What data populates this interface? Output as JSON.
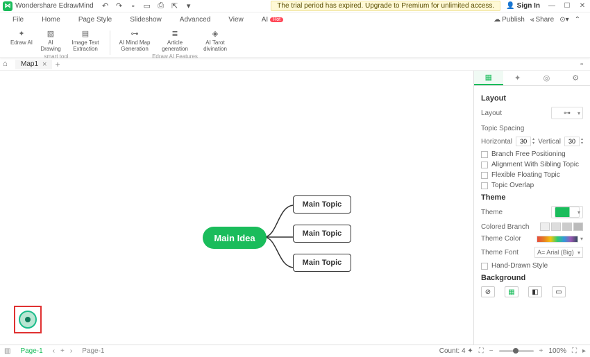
{
  "app": {
    "title": "Wondershare EdrawMind",
    "trial_msg": "The trial period has expired. Upgrade to Premium for unlimited access.",
    "signin": "Sign In"
  },
  "menus": {
    "file": "File",
    "home": "Home",
    "page_style": "Page Style",
    "slideshow": "Slideshow",
    "advanced": "Advanced",
    "view": "View",
    "ai": "AI",
    "ai_badge": "Hot",
    "publish": "Publish",
    "share": "Share"
  },
  "ribbon": {
    "group1_label": "smart tool",
    "group2_label": "Edraw AI Features",
    "edraw_ai": "Edraw\nAI",
    "ai_drawing": "AI\nDrawing",
    "image_text": "Image Text\nExtraction",
    "ai_mindmap": "AI Mind Map\nGeneration",
    "article": "Article\ngeneration",
    "tarot": "AI Tarot\ndivination"
  },
  "doc": {
    "tab_name": "Map1"
  },
  "mindmap": {
    "center": "Main Idea",
    "topic1": "Main Topic",
    "topic2": "Main Topic",
    "topic3": "Main Topic"
  },
  "panel": {
    "layout_title": "Layout",
    "layout_label": "Layout",
    "spacing_title": "Topic Spacing",
    "horizontal": "Horizontal",
    "h_val": "30",
    "vertical": "Vertical",
    "v_val": "30",
    "chk_free": "Branch Free Positioning",
    "chk_align": "Alignment With Sibling Topic",
    "chk_float": "Flexible Floating Topic",
    "chk_overlap": "Topic Overlap",
    "theme_title": "Theme",
    "theme_label": "Theme",
    "colored_branch": "Colored Branch",
    "theme_color": "Theme Color",
    "theme_font": "Theme Font",
    "font_value": "A= Arial (Big)",
    "hand_drawn": "Hand-Drawn Style",
    "background_title": "Background"
  },
  "status": {
    "page1": "Page-1",
    "page2": "Page-1",
    "count": "Count: 4",
    "zoom": "100%"
  }
}
